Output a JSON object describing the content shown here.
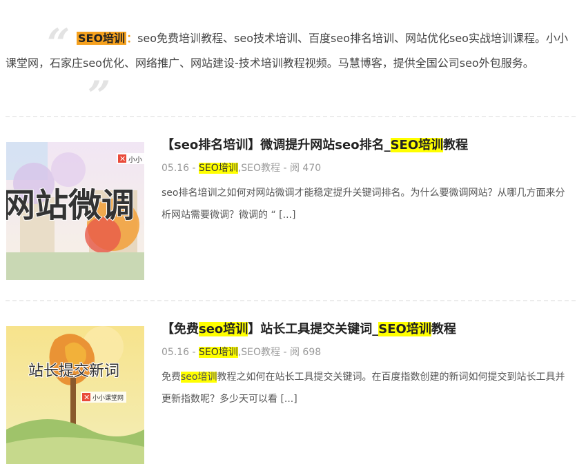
{
  "intro": {
    "tag": "SEO培训",
    "colon": "：",
    "text": "seo免费培训教程、seo技术培训、百度seo排名培训、网站优化seo实战培训课程。小小课堂网，石家庄seo优化、网络推广、网站建设-技术培训教程视频。马慧博客，提供全国公司seo外包服务。"
  },
  "posts": [
    {
      "title_prefix": "【seo排名培训】微调提升网站seo排名_",
      "title_highlight": "SEO培训",
      "title_suffix": "教程",
      "date": "05.16",
      "sep1": " - ",
      "cat1": "SEO培训",
      "cat2": ",SEO教程",
      "sep2": " - ",
      "views": "阅 470",
      "excerpt": "seo排名培训之如何对网站微调才能稳定提升关键词排名。为什么要微调网站？从哪几方面来分析网站需要微调？微调的 “ [...]",
      "thumb_text": "网站微调",
      "thumb_logo": "小小"
    },
    {
      "title_prefix": "【免费",
      "title_mid_highlight": "seo培训",
      "title_mid": "】站长工具提交关键词_",
      "title_highlight": "SEO培训",
      "title_suffix": "教程",
      "date": "05.16",
      "sep1": " - ",
      "cat1": "SEO培训",
      "cat2": ",SEO教程",
      "sep2": " - ",
      "views": "阅 698",
      "excerpt_prefix": "免费",
      "excerpt_highlight": "seo培训",
      "excerpt_rest": "教程之如何在站长工具提交关键词。在百度指数创建的新词如何提交到站长工具并更新指数呢？多少天可以看 [...]",
      "thumb_text": "站长提交新词",
      "thumb_logo": "小小课堂网"
    }
  ],
  "colors": {
    "accent": "#f5a11e",
    "highlight": "#ffff00"
  }
}
